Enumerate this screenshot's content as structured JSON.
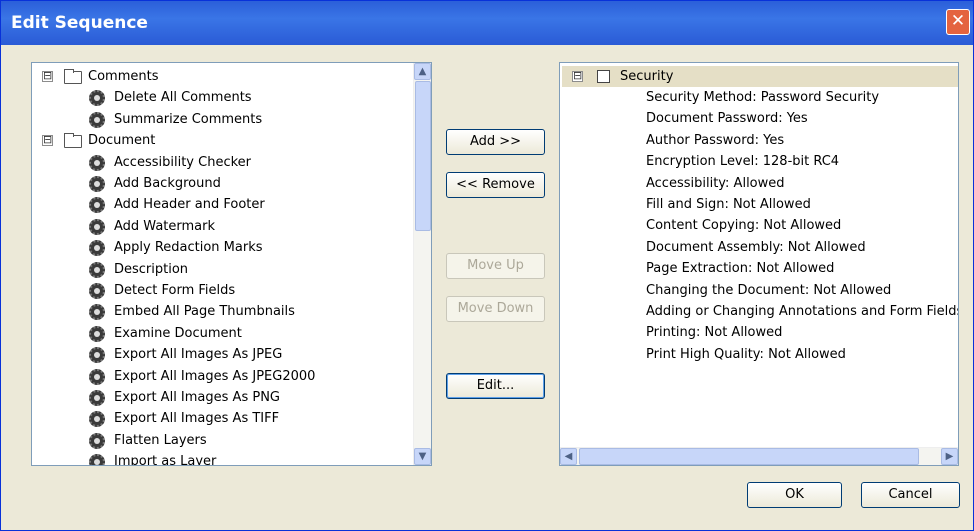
{
  "window": {
    "title": "Edit Sequence",
    "close_glyph": "✕"
  },
  "left_tree": [
    {
      "type": "group",
      "label": "Comments",
      "expander": "⊟"
    },
    {
      "type": "item",
      "label": "Delete All Comments"
    },
    {
      "type": "item",
      "label": "Summarize Comments"
    },
    {
      "type": "group",
      "label": "Document",
      "expander": "⊟"
    },
    {
      "type": "item",
      "label": "Accessibility Checker"
    },
    {
      "type": "item",
      "label": "Add Background"
    },
    {
      "type": "item",
      "label": "Add Header and Footer"
    },
    {
      "type": "item",
      "label": "Add Watermark"
    },
    {
      "type": "item",
      "label": "Apply Redaction Marks"
    },
    {
      "type": "item",
      "label": "Description"
    },
    {
      "type": "item",
      "label": "Detect Form Fields"
    },
    {
      "type": "item",
      "label": "Embed All Page Thumbnails"
    },
    {
      "type": "item",
      "label": "Examine Document"
    },
    {
      "type": "item",
      "label": "Export All Images As JPEG"
    },
    {
      "type": "item",
      "label": "Export All Images As JPEG2000"
    },
    {
      "type": "item",
      "label": "Export All Images As PNG"
    },
    {
      "type": "item",
      "label": "Export All Images As TIFF"
    },
    {
      "type": "item",
      "label": "Flatten Layers"
    },
    {
      "type": "item",
      "label": "Import as Layer"
    }
  ],
  "buttons": {
    "add": "Add >>",
    "remove": "<< Remove",
    "move_up": "Move Up",
    "move_down": "Move Down",
    "edit": "Edit...",
    "ok": "OK",
    "cancel": "Cancel"
  },
  "right_tree": {
    "group_label": "Security",
    "expander": "⊟",
    "details": [
      "Security Method: Password Security",
      "Document Password: Yes",
      "Author Password: Yes",
      "Encryption Level: 128-bit RC4",
      "Accessibility: Allowed",
      "Fill and Sign: Not Allowed",
      "Content Copying: Not Allowed",
      "Document Assembly: Not Allowed",
      "Page Extraction: Not Allowed",
      "Changing the Document: Not Allowed",
      "Adding or Changing Annotations and Form Fields",
      "Printing: Not Allowed",
      "Print High Quality: Not Allowed"
    ]
  },
  "scroll_glyphs": {
    "up": "▲",
    "down": "▼",
    "left": "◀",
    "right": "▶"
  }
}
